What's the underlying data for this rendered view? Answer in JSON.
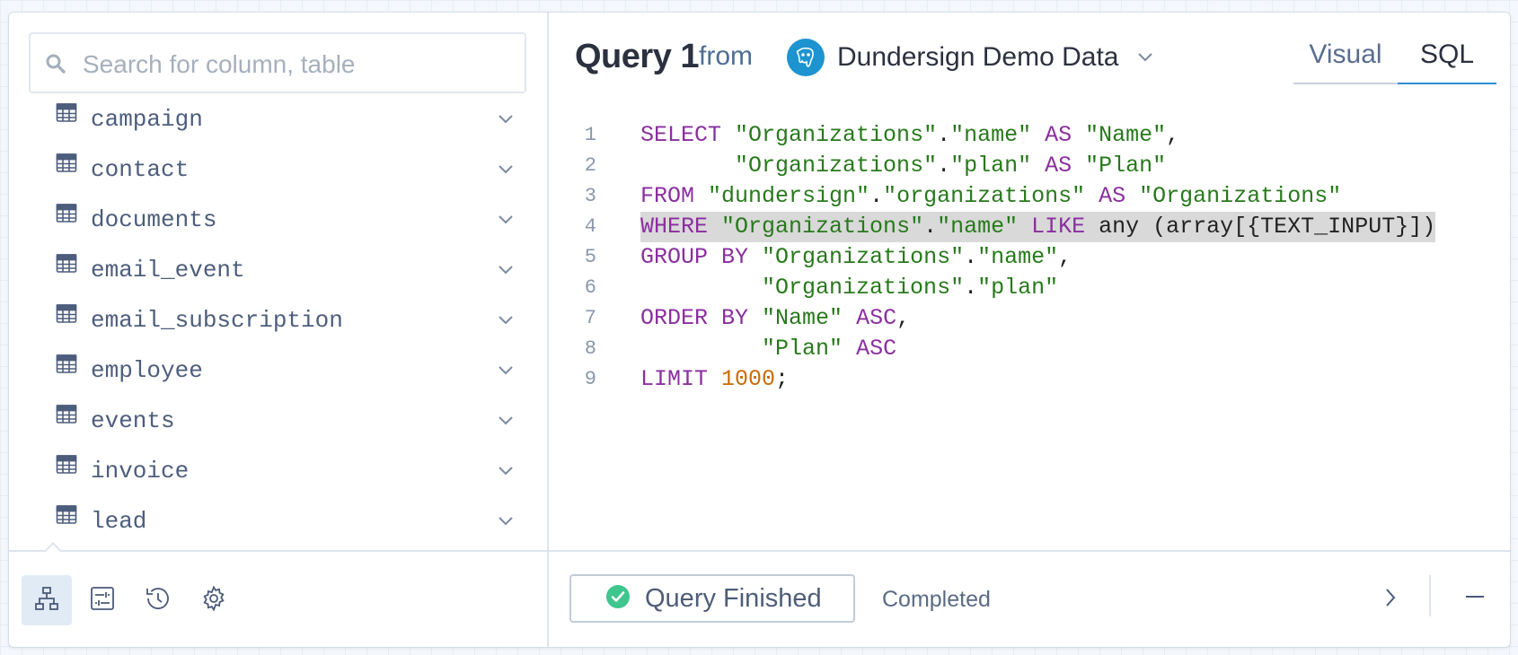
{
  "search": {
    "placeholder": "Search for column, table"
  },
  "tables": [
    {
      "name": "campaign"
    },
    {
      "name": "contact"
    },
    {
      "name": "documents"
    },
    {
      "name": "email_event"
    },
    {
      "name": "email_subscription"
    },
    {
      "name": "employee"
    },
    {
      "name": "events"
    },
    {
      "name": "invoice"
    },
    {
      "name": "lead"
    }
  ],
  "bottom_tabs": [
    {
      "icon": "schema-icon",
      "active": true
    },
    {
      "icon": "variables-icon",
      "active": false
    },
    {
      "icon": "history-icon",
      "active": false
    },
    {
      "icon": "gear-icon",
      "active": false
    }
  ],
  "header": {
    "query_title": "Query 1",
    "from_label": "from",
    "database_name": "Dundersign Demo Data",
    "database_icon": "postgresql-icon"
  },
  "mode_tabs": {
    "visual": "Visual",
    "sql": "SQL",
    "active": "SQL"
  },
  "code": {
    "highlighted_line": 4,
    "lines": [
      {
        "num": "1",
        "tokens": [
          [
            "kw",
            "SELECT"
          ],
          [
            "plain",
            " "
          ],
          [
            "str",
            "\"Organizations\""
          ],
          [
            "plain",
            "."
          ],
          [
            "str",
            "\"name\""
          ],
          [
            "plain",
            " "
          ],
          [
            "kw",
            "AS"
          ],
          [
            "plain",
            " "
          ],
          [
            "str",
            "\"Name\""
          ],
          [
            "plain",
            ","
          ]
        ]
      },
      {
        "num": "2",
        "tokens": [
          [
            "plain",
            "       "
          ],
          [
            "str",
            "\"Organizations\""
          ],
          [
            "plain",
            "."
          ],
          [
            "str",
            "\"plan\""
          ],
          [
            "plain",
            " "
          ],
          [
            "kw",
            "AS"
          ],
          [
            "plain",
            " "
          ],
          [
            "str",
            "\"Plan\""
          ]
        ]
      },
      {
        "num": "3",
        "tokens": [
          [
            "kw",
            "FROM"
          ],
          [
            "plain",
            " "
          ],
          [
            "str",
            "\"dundersign\""
          ],
          [
            "plain",
            "."
          ],
          [
            "str",
            "\"organizations\""
          ],
          [
            "plain",
            " "
          ],
          [
            "kw",
            "AS"
          ],
          [
            "plain",
            " "
          ],
          [
            "str",
            "\"Organizations\""
          ]
        ]
      },
      {
        "num": "4",
        "tokens": [
          [
            "kw",
            "WHERE"
          ],
          [
            "plain",
            " "
          ],
          [
            "str",
            "\"Organizations\""
          ],
          [
            "plain",
            "."
          ],
          [
            "str",
            "\"name\""
          ],
          [
            "plain",
            " "
          ],
          [
            "kw",
            "LIKE"
          ],
          [
            "plain",
            " any (array[{TEXT_INPUT}])"
          ]
        ]
      },
      {
        "num": "5",
        "tokens": [
          [
            "kw",
            "GROUP BY"
          ],
          [
            "plain",
            " "
          ],
          [
            "str",
            "\"Organizations\""
          ],
          [
            "plain",
            "."
          ],
          [
            "str",
            "\"name\""
          ],
          [
            "plain",
            ","
          ]
        ]
      },
      {
        "num": "6",
        "tokens": [
          [
            "plain",
            "         "
          ],
          [
            "str",
            "\"Organizations\""
          ],
          [
            "plain",
            "."
          ],
          [
            "str",
            "\"plan\""
          ]
        ]
      },
      {
        "num": "7",
        "tokens": [
          [
            "kw",
            "ORDER BY"
          ],
          [
            "plain",
            " "
          ],
          [
            "str",
            "\"Name\""
          ],
          [
            "plain",
            " "
          ],
          [
            "kw",
            "ASC"
          ],
          [
            "plain",
            ","
          ]
        ]
      },
      {
        "num": "8",
        "tokens": [
          [
            "plain",
            "         "
          ],
          [
            "str",
            "\"Plan\""
          ],
          [
            "plain",
            " "
          ],
          [
            "kw",
            "ASC"
          ]
        ]
      },
      {
        "num": "9",
        "tokens": [
          [
            "kw",
            "LIMIT"
          ],
          [
            "plain",
            " "
          ],
          [
            "num",
            "1000"
          ],
          [
            "plain",
            ";"
          ]
        ]
      }
    ]
  },
  "status": {
    "button_label": "Query Finished",
    "state": "Completed"
  },
  "colors": {
    "keyword": "#8a2f9e",
    "string": "#27791b",
    "number": "#c96a06",
    "accent": "#2e8fd8",
    "success": "#3fc58e"
  }
}
